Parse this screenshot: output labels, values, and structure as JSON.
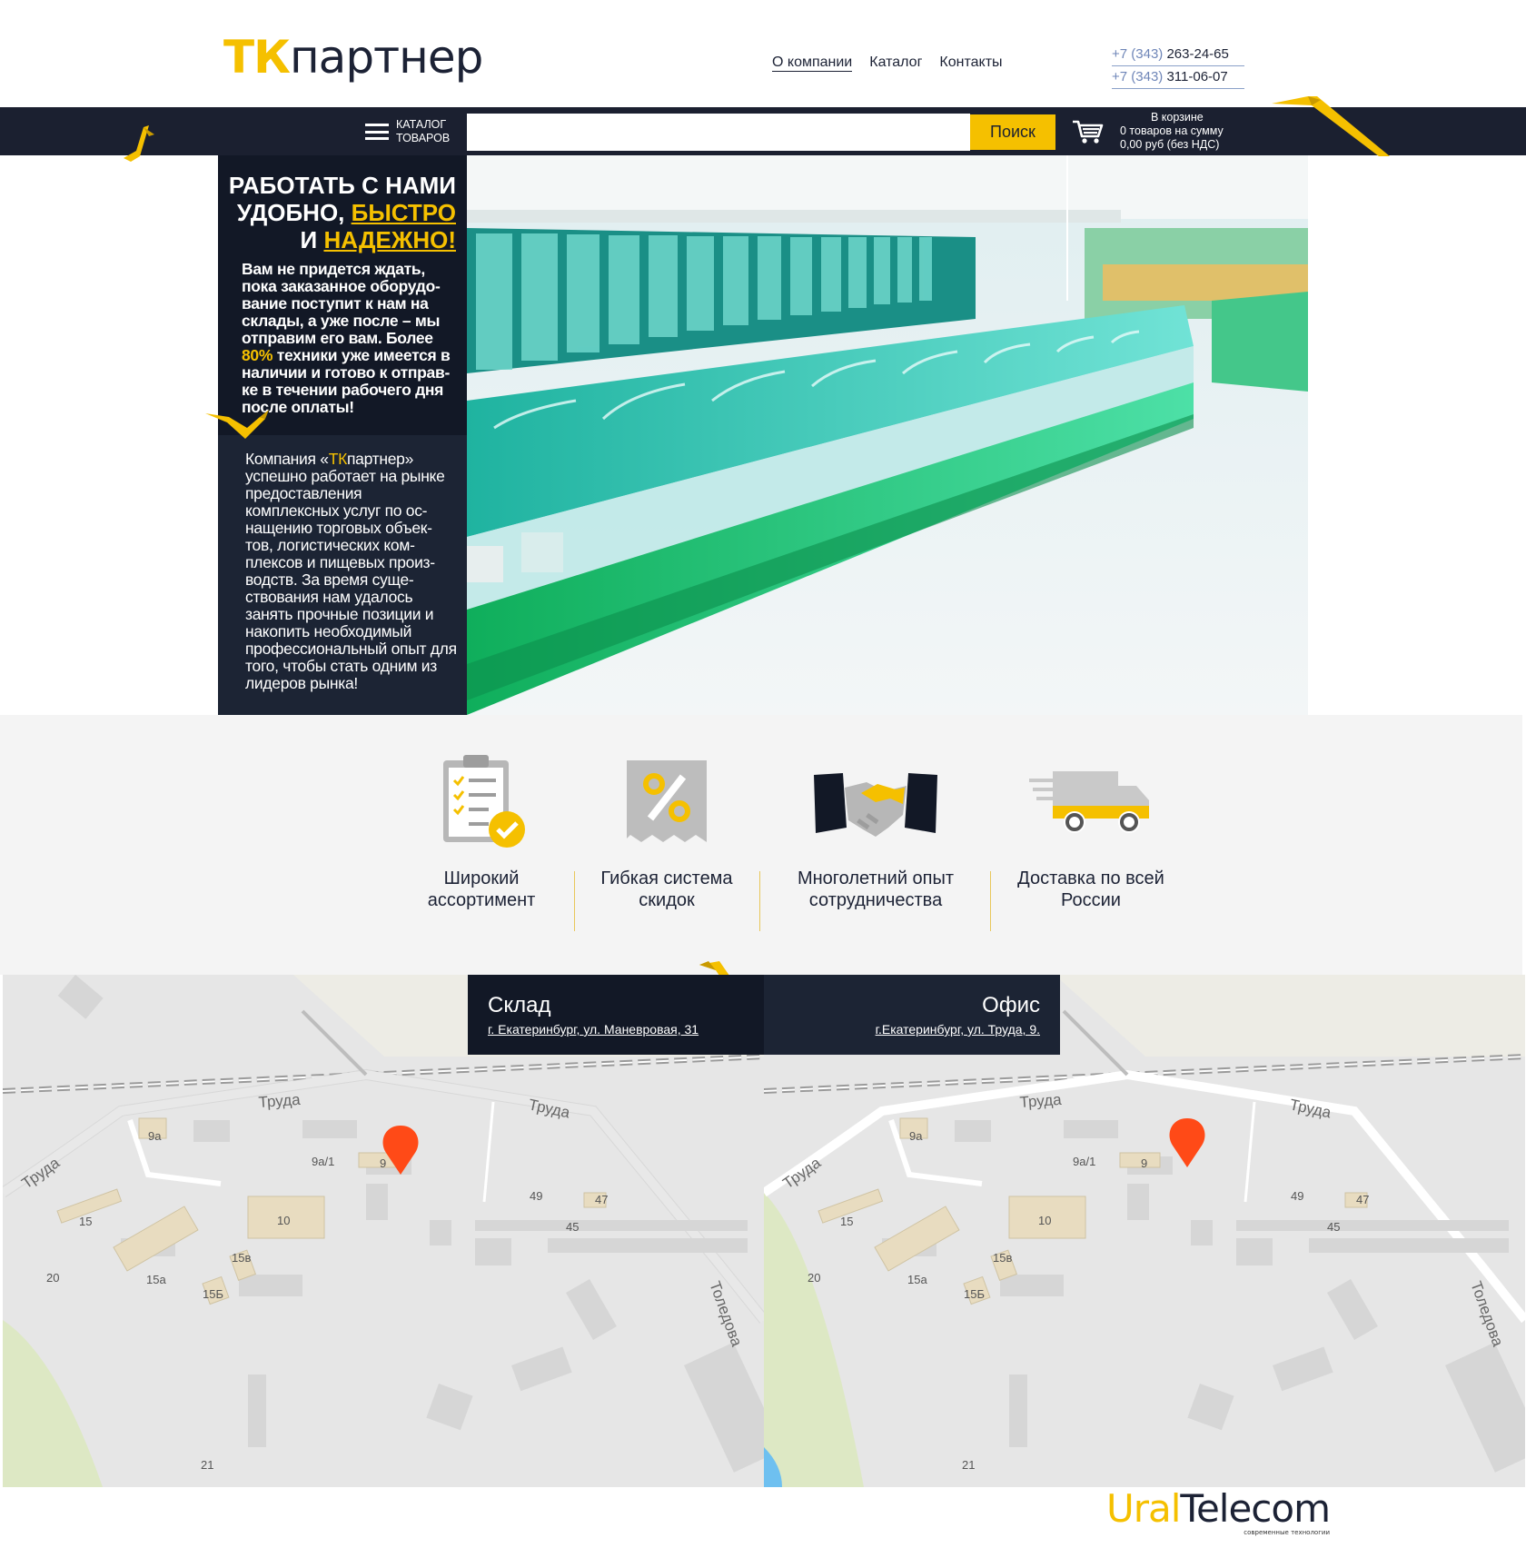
{
  "logo": {
    "prefix": "ТК",
    "rest": "партнер"
  },
  "nav": {
    "about": "О компании",
    "catalog": "Каталог",
    "contacts": "Контакты"
  },
  "phones": [
    {
      "code": "+7 (343)",
      "number": "263-24-65"
    },
    {
      "code": "+7 (343)",
      "number": "311-06-07"
    }
  ],
  "bar": {
    "catalog_line1": "КАТАЛОГ",
    "catalog_line2": "ТОВАРОВ",
    "search_placeholder": "",
    "search_button": "Поиск",
    "cart_line1": "В корзине",
    "cart_line2": "0 товаров на сумму",
    "cart_line3": "0,00 руб (без НДС)"
  },
  "hero": {
    "title_line1": "РАБОТАТЬ С НАМИ",
    "title_line2_a": "УДОБНО, ",
    "title_line2_b": "БЫСТРО",
    "title_line3_a": "И ",
    "title_line3_b": "НАДЕЖНО!",
    "p1_a": "Вам не придется ждать, пока заказанное оборудо-вание поступит к нам на склады, а уже после – мы отправим его вам. Более ",
    "p1_highlight": "80%",
    "p1_b": " техники уже имеется в наличии и готово к отправ-ке в течении рабочего дня после оплаты!",
    "p2_a": "Компания «",
    "p2_brand_tk": "ТК",
    "p2_brand_rest": "партнер",
    "p2_b": "» успешно работает на рынке предоставления комплексных услуг по ос-нащению торговых объек-тов, логистических ком-плексов и пищевых произ-водств. За время суще-ствования нам удалось занять прочные позиции и накопить необходимый профессиональный опыт для того, чтобы стать одним из лидеров рынка!"
  },
  "features": [
    {
      "line1": "Широкий",
      "line2": "ассортимент",
      "icon": "checklist-icon"
    },
    {
      "line1": "Гибкая система",
      "line2": "скидок",
      "icon": "discount-receipt-icon"
    },
    {
      "line1": "Многолетний опыт",
      "line2": "сотрудничества",
      "icon": "handshake-icon"
    },
    {
      "line1": "Доставка по всей",
      "line2": "России",
      "icon": "delivery-truck-icon"
    }
  ],
  "maps": {
    "warehouse": {
      "title": "Склад",
      "address": "г. Екатеринбург, ул. Маневровая, 31"
    },
    "office": {
      "title": "Офис",
      "address": "г.Екатеринбург, ул. Труда, 9."
    },
    "labels": {
      "street1": "Труда",
      "street2": "Труда",
      "street3": "Труда",
      "street4": "Толедова",
      "b9a": "9а",
      "b9a1": "9а/1",
      "b9": "9",
      "b10": "10",
      "b15": "15",
      "b15v": "15в",
      "b15a": "15а",
      "b15b": "15Б",
      "b20": "20",
      "b21": "21",
      "b45": "45",
      "b47": "47",
      "b49": "49"
    }
  },
  "footer": {
    "brand_a": "Ural",
    "brand_b": "Telecom",
    "tagline": "современные технологии"
  },
  "colors": {
    "accent": "#f5c000",
    "dark": "#1b2030",
    "sidebar": "#121826"
  }
}
